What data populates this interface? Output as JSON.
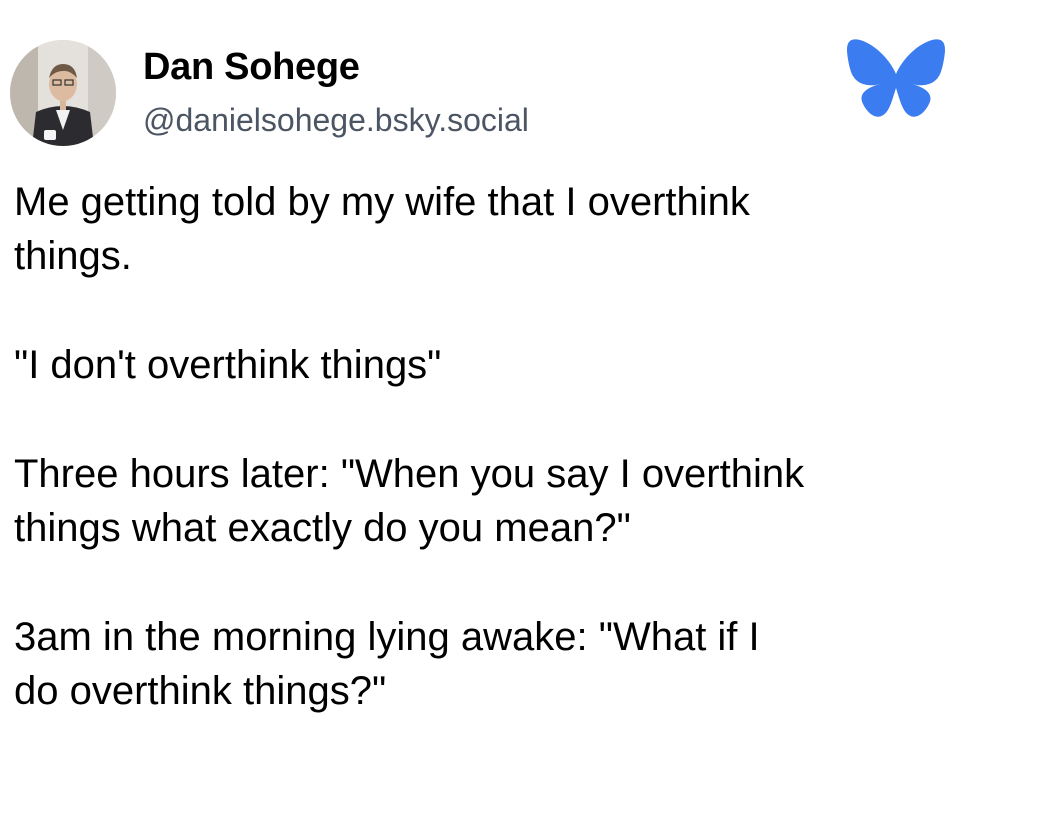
{
  "author": {
    "name": "Dan Sohege",
    "handle": "@danielsohege.bsky.social"
  },
  "brand": {
    "icon": "butterfly-icon",
    "color": "#3b7cf0"
  },
  "post": {
    "paragraphs": [
      {
        "lines": [
          "Me getting told by my wife that I overthink",
          "things."
        ]
      },
      {
        "lines": [
          "\"I don't overthink things\""
        ]
      },
      {
        "lines": [
          "Three hours later: \"When you say I overthink",
          "things what exactly do you mean?\""
        ]
      },
      {
        "lines": [
          "3am in the morning lying awake: \"What if I",
          "do overthink things?\""
        ]
      }
    ]
  }
}
